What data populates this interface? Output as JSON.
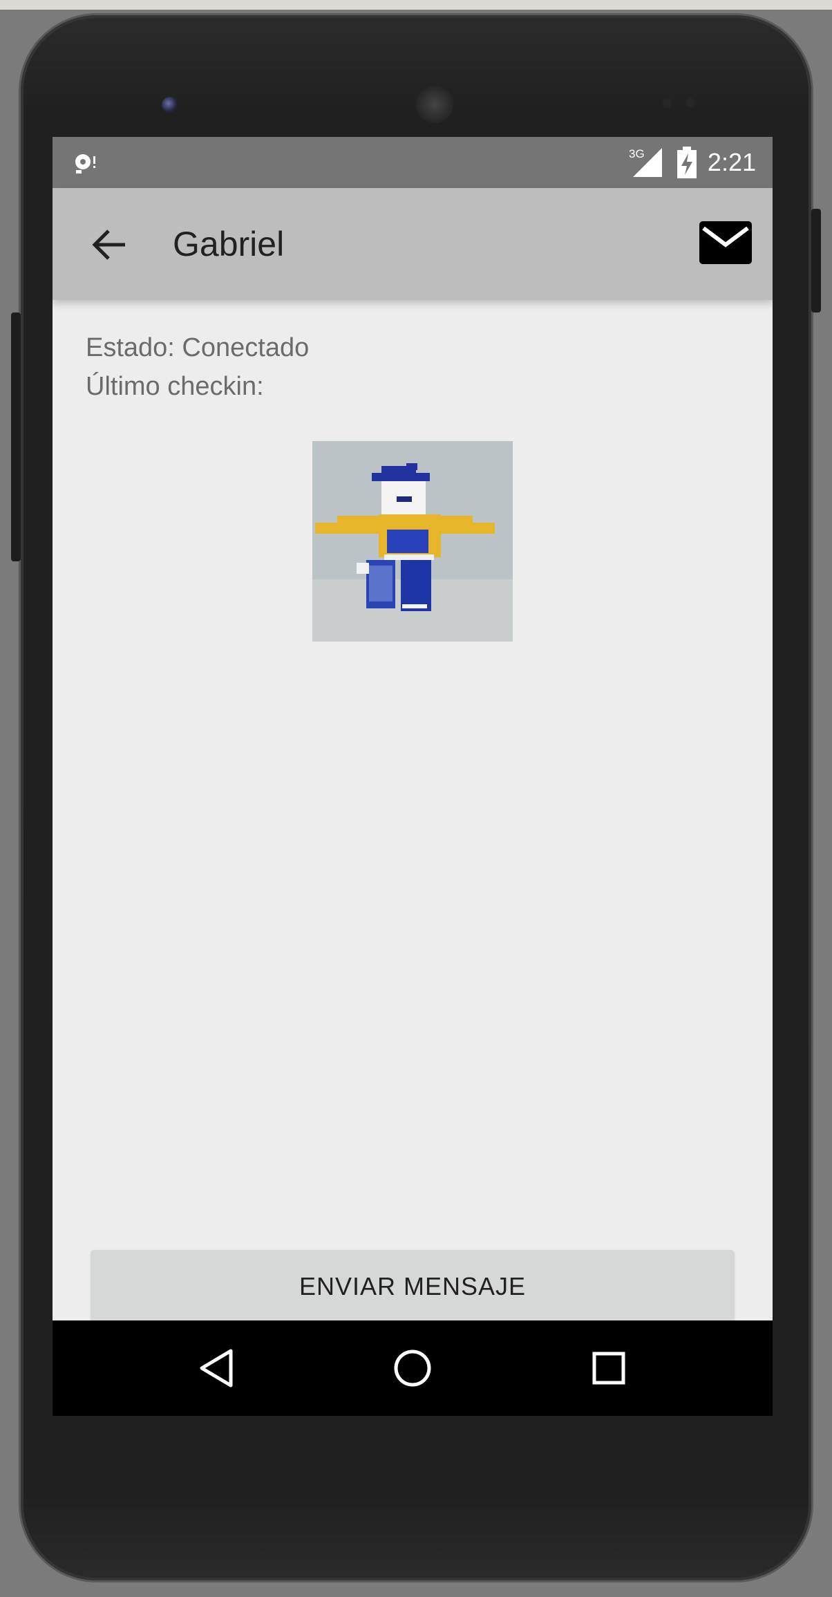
{
  "status_bar": {
    "network": "3G",
    "time": "2:21",
    "icons": [
      "notification-icon",
      "signal-icon",
      "battery-charging-icon"
    ]
  },
  "app_bar": {
    "title": "Gabriel",
    "back_icon": "arrow-back-icon",
    "action_icon": "mail-icon"
  },
  "profile": {
    "status_line": "Estado: Conectado",
    "last_checkin_line": "Último checkin:"
  },
  "send_button": {
    "label": "ENVIAR MENSAJE"
  },
  "nav_bar": {
    "icons": [
      "back-triangle-icon",
      "home-circle-icon",
      "recents-square-icon"
    ]
  },
  "colors": {
    "status_bar": "#757575",
    "app_bar": "#bdbdbd",
    "background": "#ededed",
    "button": "#d6d7d7"
  }
}
